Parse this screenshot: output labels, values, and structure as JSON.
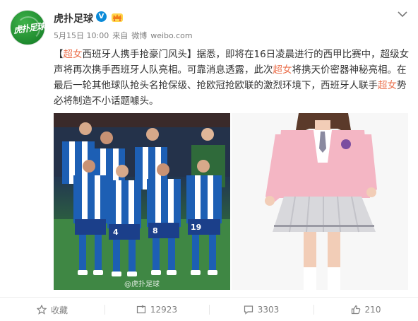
{
  "header": {
    "avatar_text": "虎扑足球",
    "user_name": "虎扑足球",
    "verified_mark": "V",
    "date": "5月15日 10:00",
    "source_prefix": "来自",
    "source": "微博",
    "domain": "weibo.com"
  },
  "post": {
    "segments": [
      {
        "text": "【",
        "highlight": false
      },
      {
        "text": "超女",
        "highlight": true
      },
      {
        "text": "西班牙人携手抢豪门风头】据悉，即将在16日凌晨进行的西甲比赛中，超级女声将再次携手西班牙人队亮相。可靠消息透露，此次",
        "highlight": false
      },
      {
        "text": "超女",
        "highlight": true
      },
      {
        "text": "将携天价密器神秘亮相。在最后一轮其他球队抢头名抢保级、抢欧冠抢欧联的激烈环境下，西班牙人联手",
        "highlight": false
      },
      {
        "text": "超女",
        "highlight": true
      },
      {
        "text": "势必将制造不小话题噱头。",
        "highlight": false
      }
    ]
  },
  "images": {
    "watermark": "@虎扑足球",
    "jersey_numbers": [
      "4",
      "8",
      "19"
    ]
  },
  "actions": {
    "favorite": {
      "label": "收藏",
      "icon": "star-icon"
    },
    "repost": {
      "count": "12923",
      "icon": "repost-icon"
    },
    "comment": {
      "count": "3303",
      "icon": "comment-icon"
    },
    "like": {
      "count": "210",
      "icon": "thumbs-up-icon"
    }
  },
  "colors": {
    "highlight": "#eb7350",
    "meta": "#808080",
    "verified": "#0a8ad8"
  }
}
